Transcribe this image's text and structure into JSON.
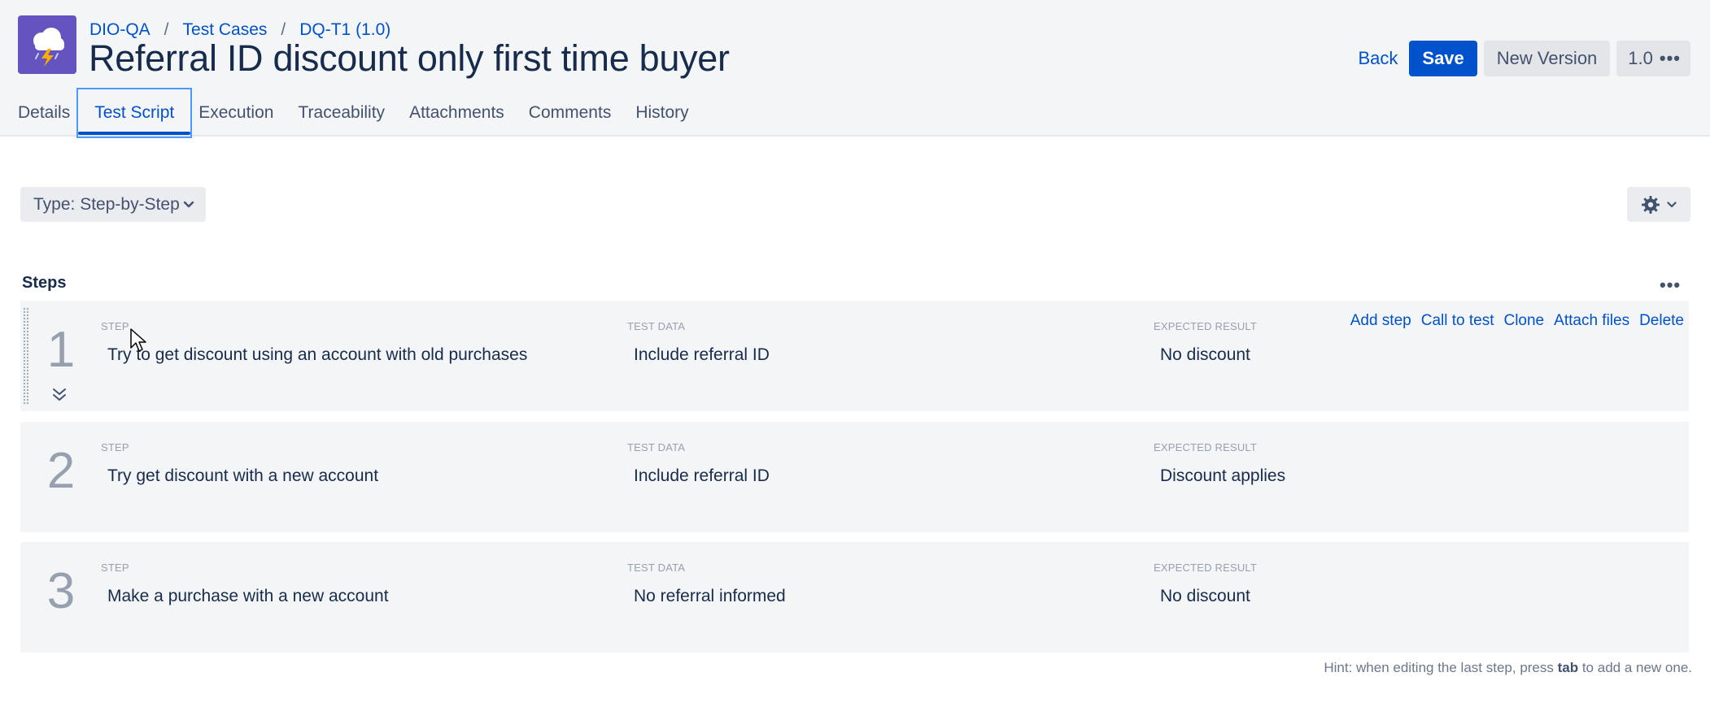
{
  "breadcrumb": {
    "project": "DIO-QA",
    "section": "Test Cases",
    "item": "DQ-T1 (1.0)",
    "separator": "/"
  },
  "title": "Referral ID discount only first time buyer",
  "actions": {
    "back": "Back",
    "save": "Save",
    "new_version": "New Version",
    "version": "1.0",
    "more": "•••"
  },
  "tabs": [
    {
      "label": "Details"
    },
    {
      "label": "Test Script",
      "active": true
    },
    {
      "label": "Execution"
    },
    {
      "label": "Traceability"
    },
    {
      "label": "Attachments"
    },
    {
      "label": "Comments"
    },
    {
      "label": "History"
    }
  ],
  "script_type": "Type: Step-by-Step",
  "steps_heading": "Steps",
  "steps_more": "•••",
  "column_labels": {
    "step": "STEP",
    "test_data": "TEST DATA",
    "expected_result": "EXPECTED RESULT"
  },
  "row_actions": [
    "Add step",
    "Call to test",
    "Clone",
    "Attach files",
    "Delete"
  ],
  "steps": [
    {
      "number": "1",
      "step": "Try to get discount using an account with old purchases",
      "test_data": "Include referral ID",
      "expected_result": "No discount"
    },
    {
      "number": "2",
      "step": "Try get discount with a new account",
      "test_data": "Include referral ID",
      "expected_result": "Discount applies"
    },
    {
      "number": "3",
      "step": "Make a purchase with a new account",
      "test_data": "No referral informed",
      "expected_result": "No discount"
    }
  ],
  "hint": {
    "prefix": "Hint: when editing the last step, press ",
    "key": "tab",
    "suffix": " to add a new one."
  },
  "icons": {
    "project_avatar": "cloud-lightning-icon",
    "settings": "gear-icon",
    "dropdown": "chevron-down-icon",
    "expand": "double-chevron-down-icon"
  },
  "colors": {
    "accent": "#0052cc",
    "avatar_bg": "#6554c0",
    "header_bg": "#f4f5f7",
    "row_bg": "#f4f5f7"
  }
}
